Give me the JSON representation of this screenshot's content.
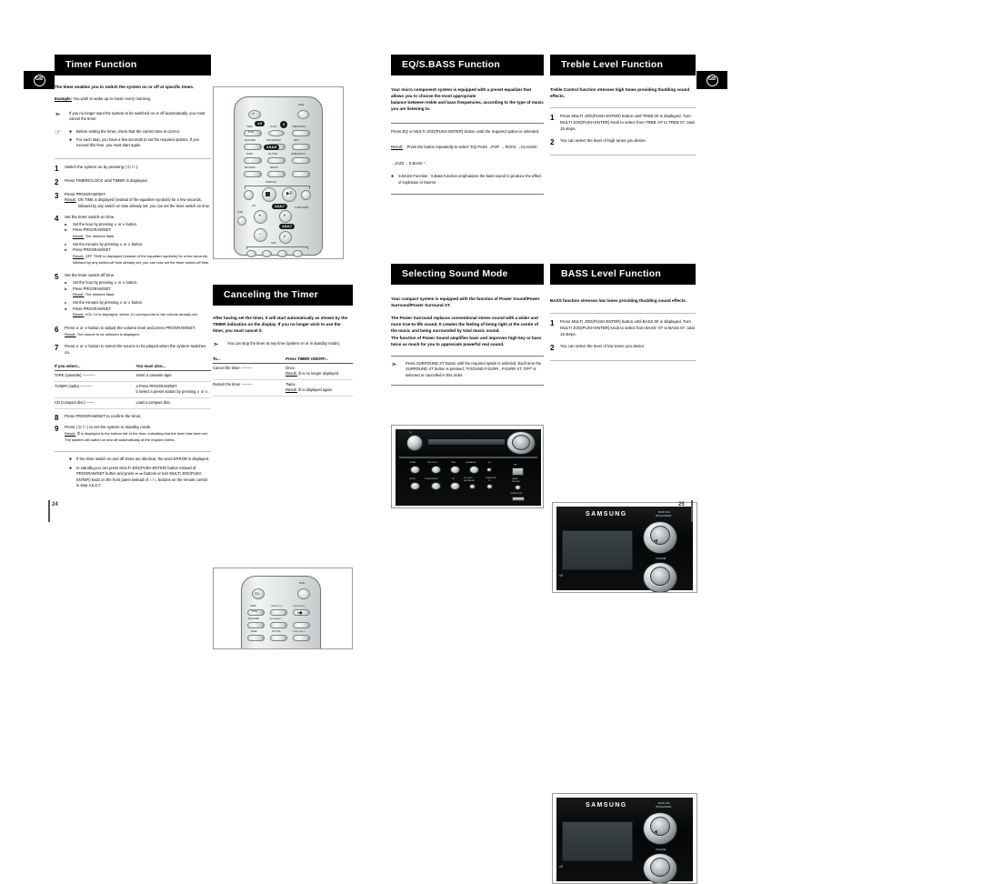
{
  "document": {
    "page_left": "24",
    "page_right": "25",
    "language_badge": "GB"
  },
  "timer_function": {
    "title": "Timer Function",
    "intro": "The timer enables you to switch the system on or off at specific times.",
    "example_label": "Example:",
    "example_text": "You wish to wake up to music every morning.",
    "note_arrow": "If you no longer want the system to be switched on or off automatically, you must cancel the timer.",
    "notes": [
      "Before setting the timer, check that the current time is correct.",
      "For each step, you have a few seconds to set the required options. If you exceed this time, you must start again."
    ],
    "steps": [
      {
        "num": "1",
        "text": "Switch the system on by pressing ( ⏻ / I )."
      },
      {
        "num": "2",
        "text": "Press TIMER/CLOCK until  TIMER  is displayed.",
        "bold": [
          "TIMER/CLOCK",
          "TIMER"
        ]
      },
      {
        "num": "3",
        "text": "Press PROGRAM/SET.",
        "result_label": "Result:",
        "result": "ON TIME is displayed (instead of the equaliser symbols) for a few seconds, followed by any switch-on time already set; you can set the timer switch-on time."
      },
      {
        "num": "4",
        "text": "Set the timer switch-on time.",
        "sub": [
          {
            "k": "a",
            "t": "Set the hour by pressing  ∧  or  ∨  button."
          },
          {
            "k": "b",
            "t": "Press PROGRAM/SET.",
            "result_label": "Result:",
            "result": "The minutes flash."
          },
          {
            "k": "c",
            "t": "Set the minutes by pressing  ∧  or  ∨  button."
          },
          {
            "k": "d",
            "t": "Press PROGRAM/SET.",
            "result_label": "Result:",
            "result": "OFF TIME is displayed (instead of the equaliser symbols) for a few seconds, followed by any switch-off time already set; you can now set the timer switch-off time."
          }
        ]
      },
      {
        "num": "5",
        "text": "Set the timer switch-off time.",
        "sub": [
          {
            "k": "a",
            "t": "Set the hour by pressing  ∧  or  ∨  button."
          },
          {
            "k": "b",
            "t": "Press PROGRAM/SET.",
            "result_label": "Result:",
            "result": "The minutes flash."
          },
          {
            "k": "c",
            "t": "Set the minutes by pressing  ∧  or  ∨  button."
          },
          {
            "k": "d",
            "t": "Press PROGRAM/SET.",
            "result_label": "Result:",
            "result": "VOL 10 is displayed, where 10 corresponds to the volume already set."
          }
        ]
      },
      {
        "num": "6",
        "text": "Press  ∧  or  ∨  button to adjust the volume level and press PROGRAM/SET.",
        "result_label": "Result:",
        "result": "The source to be selected is displayed."
      },
      {
        "num": "7",
        "text": "Press  ∧  or  ∨  button to select the source to be played when the system switches on."
      },
      {
        "num": "8",
        "text": "Press PROGRAM/SET to confirm the timer."
      },
      {
        "num": "9",
        "text": "Press ( ⏻ / I ) to set the system to standby mode.",
        "result_label": "Result:",
        "result": "⏱ is displayed in the bottom left of the time, indicating that the timer has been set. The system will switch on and off automatically at the required times."
      }
    ],
    "source_table": {
      "headers": [
        "If you select...",
        "You must also..."
      ],
      "rows": [
        {
          "select": "TAPE (cassette)",
          "action": "Insert a cassette tape."
        },
        {
          "select": "TUNER (radio)",
          "action_a": "a   Press PROGRAM/SET.",
          "action_b": "b   Select a preset station by pressing  ∧  or  ∨ ."
        },
        {
          "select": "CD (compact disc)",
          "action": "Load a compact disc."
        }
      ]
    },
    "footnotes": [
      "If the timer switch on and off times are identical, the word ERROR is displayed.",
      "In standby,you can press MULTI JOG(PUSH ENTER) button instead of PROGRAM/SET button and press ⏮ ⏭ buttons or turn MULTI JOG(PUSH ENTER) knob on the front panel instead of  ∧ / ∨  buttons on the remote control in step 4,5,6,7."
    ]
  },
  "canceling_timer": {
    "title": "Canceling the Timer",
    "intro": "After having set the timer, it will start automatically as shown by the TIMER indication on the display. If you no longer wish to use the timer, you must cancel it.",
    "note_arrow": "You can stop the timer at any time (system on or in standby mode).",
    "table": {
      "headers": [
        "To...",
        "Press TIMER ON/OFF..."
      ],
      "rows": [
        {
          "to": "Cancel the timer",
          "press": "Once.",
          "result_label": "Result:",
          "result": "⏱ is no longer displayed."
        },
        {
          "to": "Restart the timer",
          "press": "Twice.",
          "result_label": "Result:",
          "result": "⏱ is displayed again."
        }
      ]
    }
  },
  "eq_sbass": {
    "title": "EQ/S.BASS Function",
    "intro": "Your micro component system is equipped with a preset equalizer that allows you to choose the most appropriate\nbalance between treble and bass frequencies, according to the type of music you are listening to.",
    "instruction": "Press EQ or MULTI JOG(PUSH ENTER) button until the required option is selected.",
    "result_label": "Result:",
    "result": "Press the button repeatedly to select “EQ PASS→POP → ROCK →CLASSIC →JAZZ→ S.BASS ”.",
    "footnote": "S.BASS Function : S.Bass function emphasizes the bass sound to produce the effect of explosion or booms."
  },
  "sound_mode": {
    "title": "Selecting Sound Mode",
    "para1": "Your compact system is equipped with the function of Power Sound/Power Surround/Power Surround XT.",
    "para2": "The Power Surround replaces conventional stereo sound with a wider and more true-to-life sound. It creates the feeling of being right at the centre of the music and being surrounded by total music sound.\nThe function of Power Sound amplifies bass and improves high key or bass twice as much for you to appreciate powerful real sound.",
    "note_arrow": "Press SURROUND XT button until the required option is selected. Each time the SURROUND XT button is pressed, “P.SOUND,P.SURR , P.SURR XT, OFF” is selected or cancelled in this order."
  },
  "treble": {
    "title": "Treble Level Function",
    "intro": "Treble Control function stresses high tones providing thudding sound effects.",
    "steps": [
      {
        "num": "1",
        "text": "Press MULTI JOG(PUSH ENTER) button until TREB 00 is displayed. Turn MULTI JOG(PUSH ENTER) knob to select from TREB -07 to TREB 07, total 15 steps."
      },
      {
        "num": "2",
        "text": "You can select the level of high tones you desire."
      }
    ]
  },
  "bass": {
    "title": "BASS Level Function",
    "intro": "BASS function stresses low tones providing thudding sound effects.",
    "steps": [
      {
        "num": "1",
        "text": "Press MULTI JOG(PUSH ENTER) button until BASS 00 is displayed. Turn MULTI JOG(PUSH ENTER) knob to select from BASS -07 to BASS 07, total 15 steps."
      },
      {
        "num": "2",
        "text": "You can select the level of low tones you desire."
      }
    ]
  },
  "remote_main": {
    "callouts": [
      "1,9",
      "2",
      "3,5,6,8",
      "4,5,6,7",
      "4,5,6,7"
    ],
    "labels": {
      "mute": "MUTE",
      "power": "⏻/I",
      "timer": "TIMER",
      "clock": "CLOCK",
      "band": "BAND",
      "demo": "DEMO",
      "timer_onoff": "TIMER ON/OFF",
      "equalizer": "EQUALIZER",
      "program_set": "PROGRAM/SET",
      "rept": "REPT",
      "sleep": "SLEEP",
      "cd_tv_ht": "CD-TYPE/",
      "mo_st": "MO/ST",
      "surround": "SURROUND XT",
      "rds": "RDS MODE",
      "display": "DISPLAY",
      "cd_mp3": "CD/MP3-CD",
      "vol": "VOL",
      "tuning_mode": "TUNING MODE",
      "tone": "TONE",
      "tape": "TAPE"
    }
  },
  "remote_small": {
    "labels": {
      "power": "⏻/I",
      "mute": "MUTE",
      "timer": "TIMER",
      "band": "BAND",
      "clock": "TIMER/CLOCK",
      "onoff": "TIMER ON/OFF",
      "equalizer": "EQUALIZER",
      "program": "PROGRAM/SET",
      "sleep": "SLEEP",
      "cdtype": "CD-TYPE",
      "surround": "SURROUND XT"
    }
  },
  "unit_panel_eq": {
    "labels": {
      "power": "⏻/I",
      "tuner": "TUNER",
      "mp3cd": "MP3-CD/CD",
      "tape": "TAPE",
      "usb_pause": "USB/PAUSE",
      "eq": "EQ",
      "down": "DOWN",
      "tuning_mode": "TUNING MODE",
      "up": "UP",
      "cd_sync": "CD SYNC /",
      "rec_pause": "REC/PAUSE",
      "surround": "SURROUND",
      "xt": "XT",
      "usb_icon": "USB",
      "demo_snooze": "DEMO/",
      "snooze": "SNOOZE",
      "open_close": "OPEN/CLOSE"
    }
  },
  "unit_panel_knob": {
    "brand": "SAMSUNG",
    "multi_jog": "MULTI JOG",
    "push_enter": "(PUSH ENTER)",
    "volume": "VOLUME",
    "power": "⏻/I"
  }
}
